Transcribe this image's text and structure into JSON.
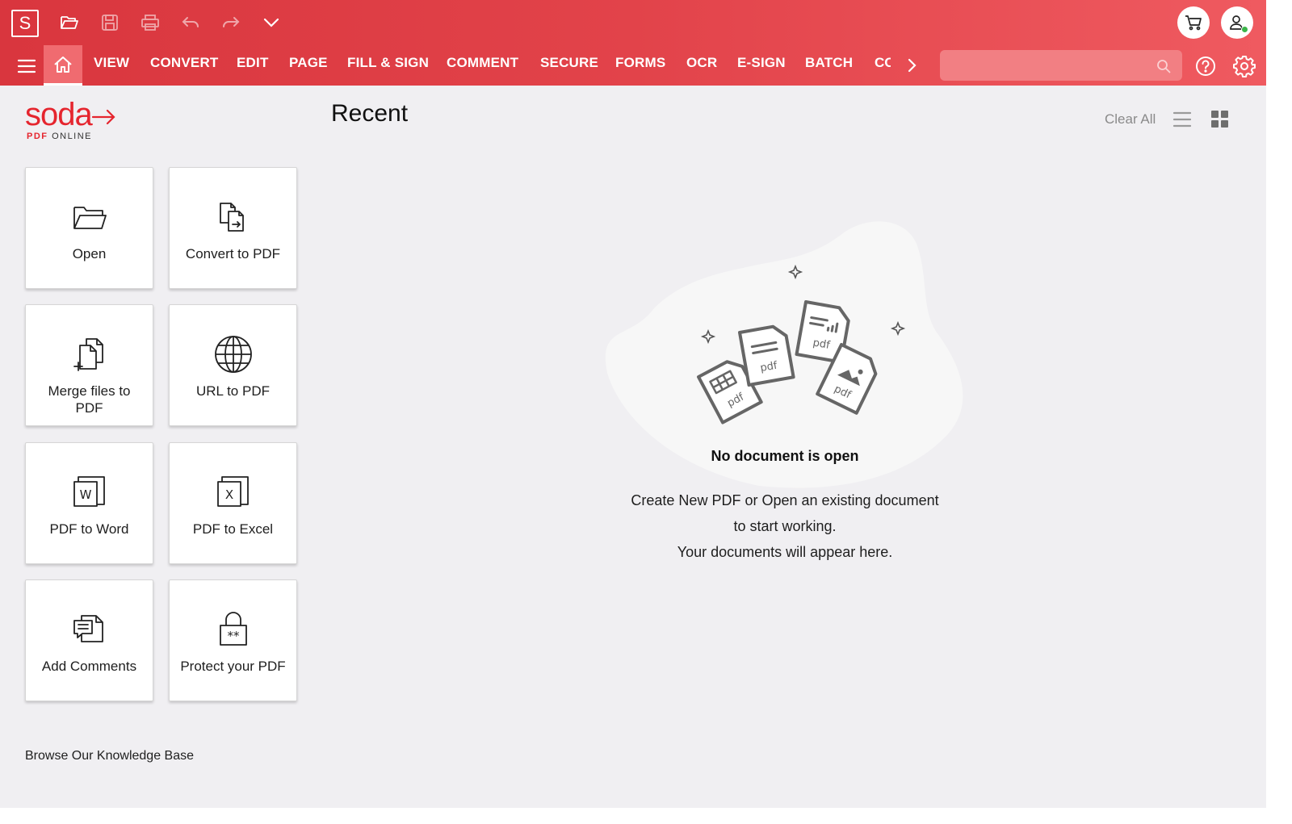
{
  "toolbar": {
    "app_letter": "S",
    "icons": [
      "open-folder-icon",
      "save-icon",
      "print-icon",
      "undo-icon",
      "redo-icon",
      "chevron-down-icon",
      "cart-icon",
      "user-icon"
    ]
  },
  "nav": {
    "items": [
      "VIEW",
      "CONVERT",
      "EDIT",
      "PAGE",
      "FILL & SIGN",
      "COMMENT",
      "SECURE",
      "FORMS",
      "OCR",
      "E-SIGN",
      "BATCH"
    ],
    "overflow_item": "CO",
    "search_placeholder": ""
  },
  "brand": {
    "name": "soda",
    "sub_bold": "PDF",
    "sub_rest": "ONLINE"
  },
  "tiles": [
    {
      "label": "Open",
      "icon": "open-folder-icon"
    },
    {
      "label": "Convert to PDF",
      "icon": "convert-icon"
    },
    {
      "label": "Merge files to PDF",
      "icon": "merge-icon"
    },
    {
      "label": "URL to PDF",
      "icon": "globe-icon"
    },
    {
      "label": "PDF to Word",
      "icon": "word-icon"
    },
    {
      "label": "PDF to Excel",
      "icon": "excel-icon"
    },
    {
      "label": "Add Comments",
      "icon": "comments-icon"
    },
    {
      "label": "Protect your PDF",
      "icon": "lock-icon"
    }
  ],
  "knowledge_base": "Browse Our Knowledge Base",
  "recent": {
    "title": "Recent",
    "clear_all": "Clear All",
    "empty_title": "No document is open",
    "empty_lines": [
      "Create New PDF or Open an existing document",
      "to start working.",
      "Your documents will appear here."
    ],
    "illustration_label": "pdf"
  },
  "colors": {
    "accent": "#e5252e",
    "header_start": "#d9363e",
    "header_end": "#ef5a60",
    "background": "#f0eff2",
    "status_online": "#3bb54a"
  }
}
